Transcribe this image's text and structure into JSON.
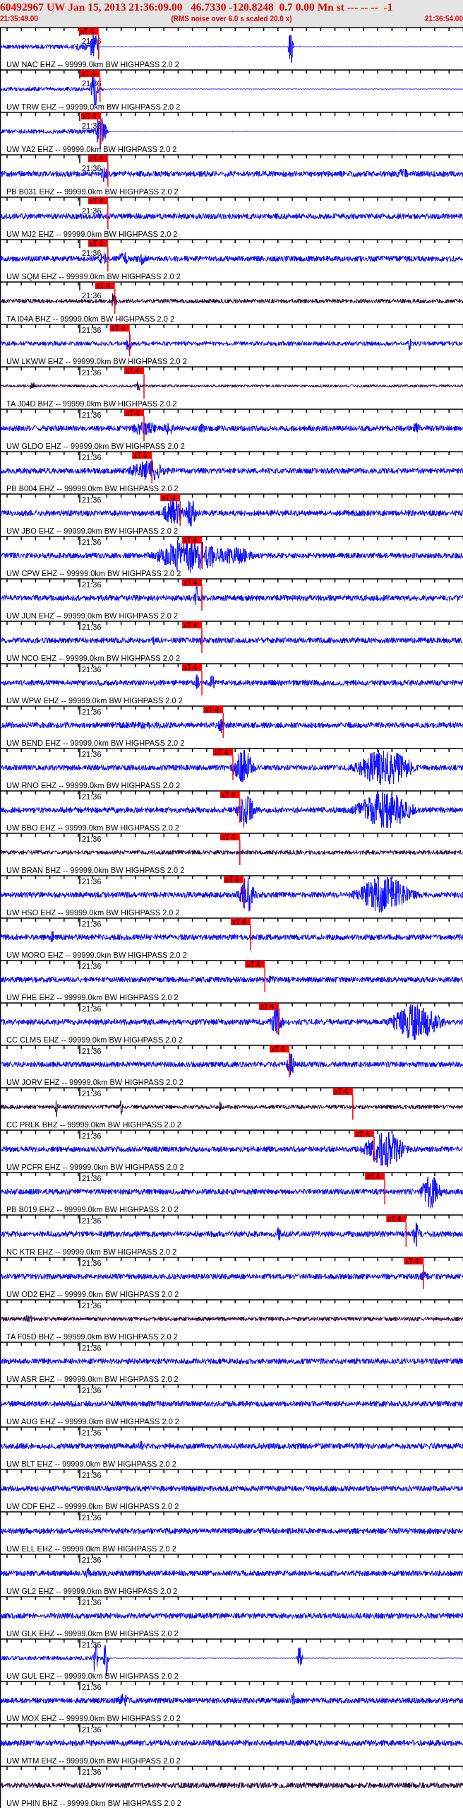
{
  "header": {
    "title": "60492967 UW Jan 15, 2013 21:36:09.00   46.7330 -120.8248  0.7 0.00 Mn st --- -- --  -1",
    "start_time": "21:35:49.00",
    "note": "(RMS noise over 6.0 s scaled 20.0 x)",
    "end_time": "21:36:54.00"
  },
  "traces": [
    {
      "label": "UW NAC EHZ -- 99999.0km BW HIGHPASS 2.0 2",
      "time_label": "21:36",
      "color": "#0000ff",
      "pick": {
        "label": "xT 4",
        "level": 0.213
      }
    },
    {
      "label": "UW TRW EHZ -- 99999.0km BW HIGHPASS 2.0 2",
      "time_label": "21:36",
      "color": "#0000ff",
      "pick": {
        "label": "xT 4",
        "level": 0.216
      }
    },
    {
      "label": "UW YA2 EHZ -- 99999.0km BW HIGHPASS 2.0 2",
      "time_label": "21:36",
      "color": "#0000ff",
      "pick": {
        "label": "xT 4",
        "level": 0.218
      }
    },
    {
      "label": "PB B031 EHZ -- 99999.0km BW HIGHPASS 2.0 2",
      "time_label": "21:36",
      "color": "#0000ff",
      "pick": {
        "label": "xT 4",
        "level": 0.233
      }
    },
    {
      "label": "UW MJ2 EHZ -- 99999.0km BW HIGHPASS 2.0 2",
      "time_label": "21:36",
      "color": "#0000ff",
      "pick": {
        "label": "xT 4",
        "level": 0.233
      }
    },
    {
      "label": "UW SQM EHZ -- 99999.0km BW HIGHPASS 2.0 2",
      "time_label": "21:36",
      "color": "#0000ff",
      "pick": {
        "label": "xT 4",
        "level": 0.233
      }
    },
    {
      "label": "TA I04A BHZ -- 99999.0km BW HIGHPASS 2.0 2",
      "time_label": "21:36",
      "color": "#200040",
      "pick": {
        "label": "xT 4",
        "level": 0.248
      }
    },
    {
      "label": "UW LKWW EHZ -- 99999.0km BW HIGHPASS 2.0 2",
      "time_label": "21:36",
      "color": "#0000ff",
      "pick": {
        "label": "xT 4",
        "level": 0.28
      }
    },
    {
      "label": "TA J04D BHZ -- 99999.0km BW HIGHPASS 2.0 2",
      "time_label": "21:36",
      "color": "#200040",
      "pick": {
        "label": "xT 4",
        "level": 0.311
      }
    },
    {
      "label": "UW GLDO EHZ -- 99999.0km BW HIGHPASS 2.0 2",
      "time_label": "21:36",
      "color": "#0000ff",
      "pick": {
        "label": "xT 4",
        "level": 0.311
      }
    },
    {
      "label": "PB B004 EHZ -- 99999.0km BW HIGHPASS 2.0 2",
      "time_label": "21:36",
      "color": "#0000ff",
      "pick": {
        "label": "xT 4",
        "level": 0.328
      }
    },
    {
      "label": "UW JBO EHZ -- 99999.0km BW HIGHPASS 2.0 2",
      "time_label": "21:36",
      "color": "#0000ff",
      "pick": {
        "label": "xT 4",
        "level": 0.389
      }
    },
    {
      "label": "UW CPW EHZ -- 99999.0km BW HIGHPASS 2.0 2",
      "time_label": "21:36",
      "color": "#0000ff",
      "pick": {
        "label": "xT 4",
        "level": 0.436
      }
    },
    {
      "label": "UW JUN EHZ -- 99999.0km BW HIGHPASS 2.0 2",
      "time_label": "21:36",
      "color": "#0000ff",
      "pick": {
        "label": "xT 4",
        "level": 0.436
      }
    },
    {
      "label": "UW NCO EHZ -- 99999.0km BW HIGHPASS 2.0 2",
      "time_label": "21:36",
      "color": "#0000ff",
      "pick": {
        "label": "xT 4",
        "level": 0.436
      }
    },
    {
      "label": "UW WPW EHZ -- 99999.0km BW HIGHPASS 2.0 2",
      "time_label": "21:36",
      "color": "#0000ff",
      "pick": {
        "label": "xT 4",
        "level": 0.436
      }
    },
    {
      "label": "UW BEND EHZ -- 99999.0km BW HIGHPASS 2.0 2",
      "time_label": "21:36",
      "color": "#0000ff",
      "pick": {
        "label": "xT 4",
        "level": 0.482
      }
    },
    {
      "label": "UW RNO EHZ -- 99999.0km BW HIGHPASS 2.0 2",
      "time_label": "21:36",
      "color": "#0000ff",
      "pick": {
        "label": "xT 4",
        "level": 0.503
      }
    },
    {
      "label": "UW BBO EHZ -- 99999.0km BW HIGHPASS 2.0 2",
      "time_label": "21:36",
      "color": "#0000ff",
      "pick": {
        "label": "xT 4",
        "level": 0.518
      }
    },
    {
      "label": "UW BRAN BHZ -- 99999.0km BW HIGHPASS 2.0 2",
      "time_label": "21:36",
      "color": "#200040",
      "pick": {
        "label": "xT 4",
        "level": 0.518
      }
    },
    {
      "label": "UW HSO EHZ -- 99999.0km BW HIGHPASS 2.0 2",
      "time_label": "21:36",
      "color": "#0000ff",
      "pick": {
        "label": "xT 4",
        "level": 0.526
      }
    },
    {
      "label": "UW MORO EHZ -- 99999.0km BW HIGHPASS 2.0 2",
      "time_label": "21:36",
      "color": "#0000ff",
      "pick": {
        "label": "xT 4",
        "level": 0.541
      }
    },
    {
      "label": "UW FHE EHZ -- 99999.0km BW HIGHPASS 2.0 2",
      "time_label": "21:36",
      "color": "#0000ff",
      "pick": {
        "label": "xT 4",
        "level": 0.572
      }
    },
    {
      "label": "CC CLMS EHZ -- 99999.0km BW HIGHPASS 2.0 2",
      "time_label": "21:36",
      "color": "#0000ff",
      "pick": {
        "label": "xT 4",
        "level": 0.602
      }
    },
    {
      "label": "UW JORV EHZ -- 99999.0km BW HIGHPASS 2.0 2",
      "time_label": "21:36",
      "color": "#0000ff",
      "pick": {
        "label": "xT 4",
        "level": 0.625
      }
    },
    {
      "label": "CC PRLK BHZ -- 99999.0km BW HIGHPASS 2.0 2",
      "time_label": "21:36",
      "color": "#200040",
      "pick": {
        "label": "xT 4",
        "level": 0.762
      }
    },
    {
      "label": "UW PCFR EHZ -- 99999.0km BW HIGHPASS 2.0 2",
      "time_label": "21:36",
      "color": "#0000ff",
      "pick": {
        "label": "xT 4",
        "level": 0.808
      }
    },
    {
      "label": "PB B019 EHZ -- 99999.0km BW HIGHPASS 2.0 2",
      "time_label": "21:36",
      "color": "#0000ff",
      "pick": {
        "label": "xT 4",
        "level": 0.831
      }
    },
    {
      "label": "NC KTR EHZ -- 99999.0km BW HIGHPASS 2.0 2",
      "time_label": "21:36",
      "color": "#0000ff",
      "pick": {
        "label": "xT 4",
        "level": 0.877
      }
    },
    {
      "label": "UW OD2 EHZ -- 99999.0km BW HIGHPASS 2.0 2",
      "time_label": "21:36",
      "color": "#0000ff",
      "pick": {
        "label": "xT 4",
        "level": 0.915
      }
    },
    {
      "label": "TA F05D BHZ -- 99999.0km BW HIGHPASS 2.0 2",
      "time_label": "21:36",
      "color": "#200040"
    },
    {
      "label": "UW ASR EHZ -- 99999.0km BW HIGHPASS 2.0 2",
      "time_label": "21:36",
      "color": "#0000ff"
    },
    {
      "label": "UW AUG EHZ -- 99999.0km BW HIGHPASS 2.0 2",
      "time_label": "21:36",
      "color": "#0000ff"
    },
    {
      "label": "UW BLT EHZ -- 99999.0km BW HIGHPASS 2.0 2",
      "time_label": "21:36",
      "color": "#0000ff"
    },
    {
      "label": "UW CDF EHZ -- 99999.0km BW HIGHPASS 2.0 2",
      "time_label": "21:36",
      "color": "#0000ff"
    },
    {
      "label": "UW ELL EHZ -- 99999.0km BW HIGHPASS 2.0 2",
      "time_label": "21:36",
      "color": "#0000ff"
    },
    {
      "label": "UW GL2 EHZ -- 99999.0km BW HIGHPASS 2.0 2",
      "time_label": "21:36",
      "color": "#0000ff"
    },
    {
      "label": "UW GLK EHZ -- 99999.0km BW HIGHPASS 2.0 2",
      "time_label": "21:36",
      "color": "#0000ff"
    },
    {
      "label": "UW GUL EHZ -- 99999.0km BW HIGHPASS 2.0 2",
      "time_label": "21:36",
      "color": "#0000ff"
    },
    {
      "label": "UW MOX EHZ -- 99999.0km BW HIGHPASS 2.0 2",
      "time_label": "21:36",
      "color": "#0000ff"
    },
    {
      "label": "UW MTM EHZ -- 99999.0km BW HIGHPASS 2.0 2",
      "time_label": "21:36",
      "color": "#0000ff"
    },
    {
      "label": "UW PHIN BHZ -- 99999.0km BW HIGHPASS 2.0 2",
      "time_label": "21:36",
      "color": "#200040"
    }
  ]
}
